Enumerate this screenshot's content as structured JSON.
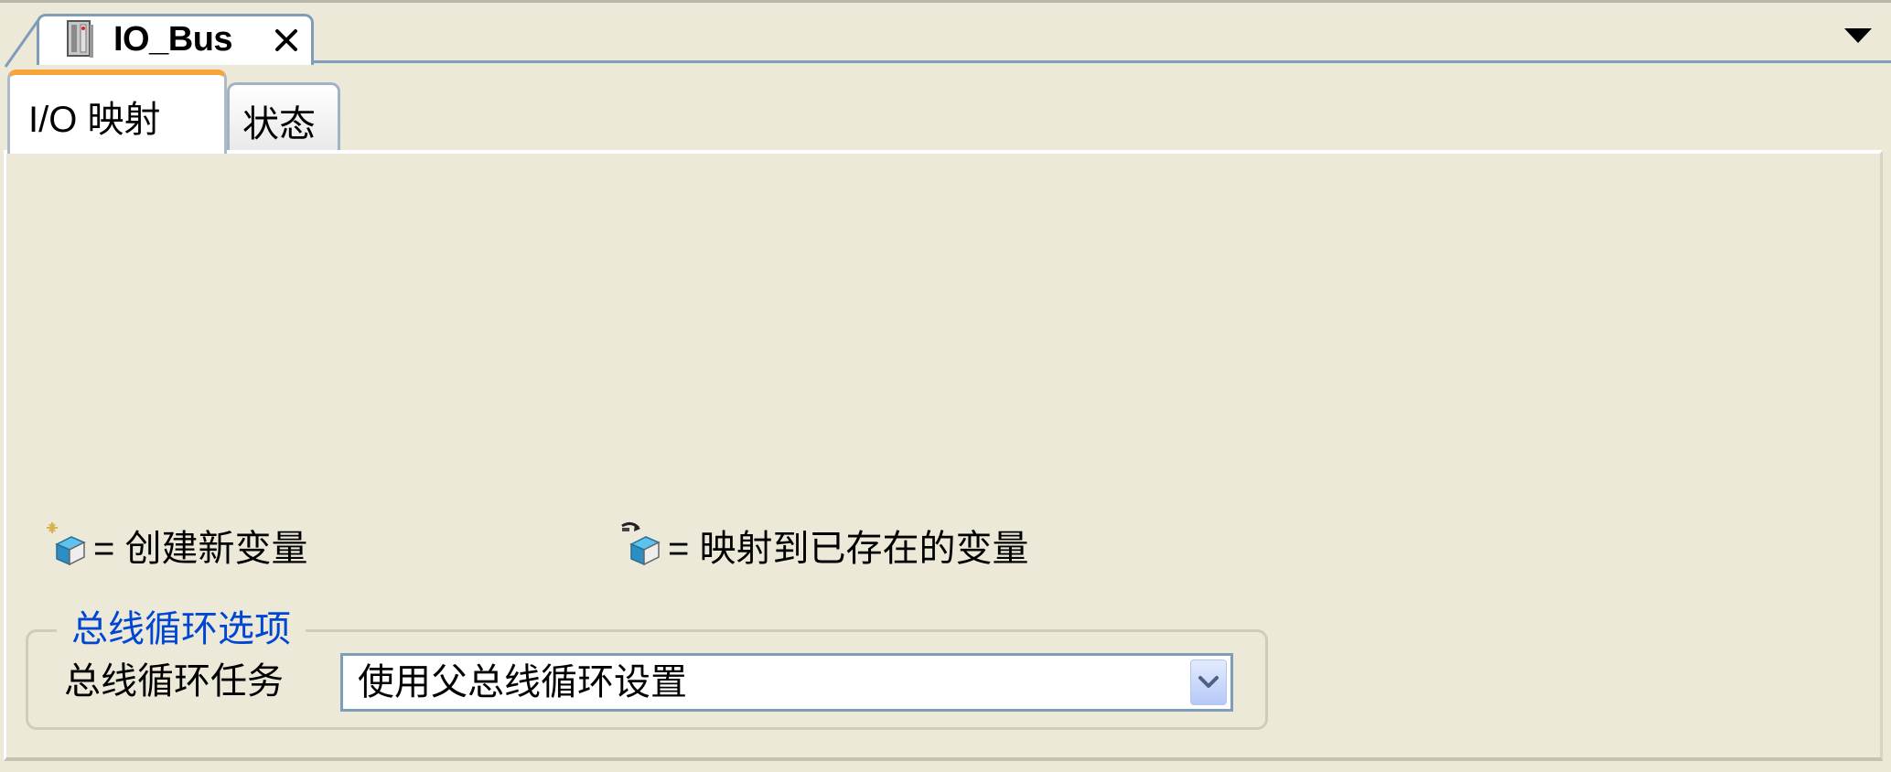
{
  "document_tab": {
    "title": "IO_Bus",
    "icon": "device-icon",
    "close_icon": "close-icon"
  },
  "tab_list_menu_icon": "dropdown-arrow-icon",
  "tabs": [
    {
      "label": "I/O 映射",
      "active": true
    },
    {
      "label": "状态",
      "active": false
    }
  ],
  "legend": {
    "create_new": "= 创建新变量",
    "map_existing": "= 映射到已存在的变量"
  },
  "bus_cycle_options": {
    "title": "总线循环选项",
    "task_label": "总线循环任务",
    "task_value": "使用父总线循环设置"
  },
  "colors": {
    "background": "#ece9d8",
    "active_tab_accent": "#f7a53a",
    "group_title": "#0046d5",
    "border_blue": "#7f9db9"
  }
}
